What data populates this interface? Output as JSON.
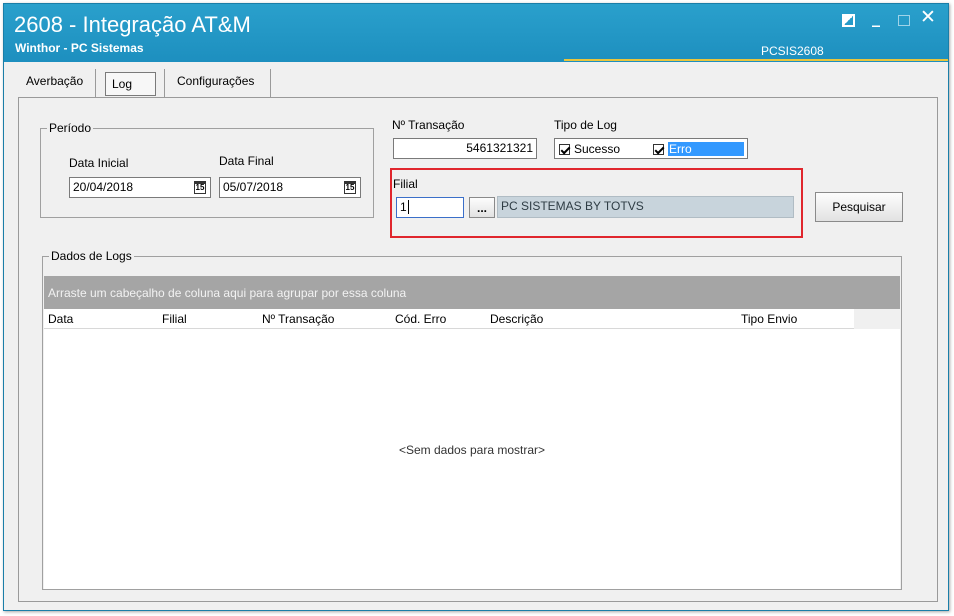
{
  "window": {
    "title": "2608 - Integração AT&M",
    "subtitle": "Winthor - PC Sistemas",
    "routine_code": "PCSIS2608",
    "accent_color": "#1d8fbf"
  },
  "tabs": [
    {
      "label": "Averbação"
    },
    {
      "label": "Log"
    },
    {
      "label": "Configurações"
    }
  ],
  "periodo": {
    "legend": "Período",
    "data_inicial_label": "Data Inicial",
    "data_inicial_value": "20/04/2018",
    "data_final_label": "Data Final",
    "data_final_value": "05/07/2018",
    "calendar_icon_text": "15"
  },
  "transacao": {
    "label": "Nº Transação",
    "value": "5461321321"
  },
  "tipo_log": {
    "label": "Tipo de Log",
    "options": [
      {
        "label": "Sucesso",
        "checked": true
      },
      {
        "label": "Erro",
        "checked": true
      }
    ]
  },
  "filial": {
    "label": "Filial",
    "code_value": "1",
    "lookup_button": "...",
    "name_value": "PC SISTEMAS BY TOTVS",
    "highlight_color": "#e0262d"
  },
  "pesquisar_button": "Pesquisar",
  "logs": {
    "legend": "Dados de Logs",
    "group_hint": "Arraste um cabeçalho de coluna aqui para agrupar por essa coluna",
    "columns": [
      "Data",
      "Filial",
      "Nº Transação",
      "Cód. Erro",
      "Descrição",
      "Tipo Envio"
    ],
    "empty_message": "<Sem dados para mostrar>"
  }
}
